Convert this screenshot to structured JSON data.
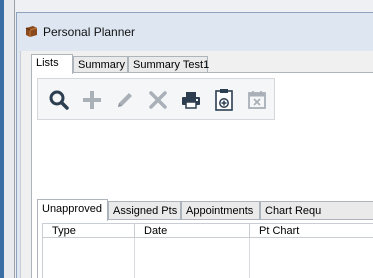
{
  "window": {
    "title": "Personal Planner",
    "app_icon": "planner-book-icon"
  },
  "main_tabs": [
    {
      "label": "Lists",
      "active": true
    },
    {
      "label": "Summary",
      "active": false
    },
    {
      "label": "Summary Test1",
      "active": false
    }
  ],
  "toolbar": {
    "buttons": [
      {
        "name": "search",
        "icon": "search-icon",
        "enabled": true
      },
      {
        "name": "add",
        "icon": "plus-icon",
        "enabled": false
      },
      {
        "name": "edit",
        "icon": "pencil-icon",
        "enabled": false
      },
      {
        "name": "delete",
        "icon": "x-icon",
        "enabled": false
      },
      {
        "name": "print",
        "icon": "printer-icon",
        "enabled": true
      },
      {
        "name": "clipboard-add",
        "icon": "clipboard-plus-icon",
        "enabled": true
      },
      {
        "name": "calendar-remove",
        "icon": "calendar-x-icon",
        "enabled": false
      }
    ]
  },
  "list_tabs": [
    {
      "label": "Unapproved",
      "active": true
    },
    {
      "label": "Assigned Pts",
      "active": false
    },
    {
      "label": "Appointments",
      "active": false
    },
    {
      "label": "Chart Requ",
      "active": false
    }
  ],
  "grid": {
    "columns": [
      "Type",
      "Date",
      "Pt Chart"
    ]
  },
  "colors": {
    "icon_dark": "#2c3e50",
    "icon_disabled": "#a9b0b7"
  }
}
